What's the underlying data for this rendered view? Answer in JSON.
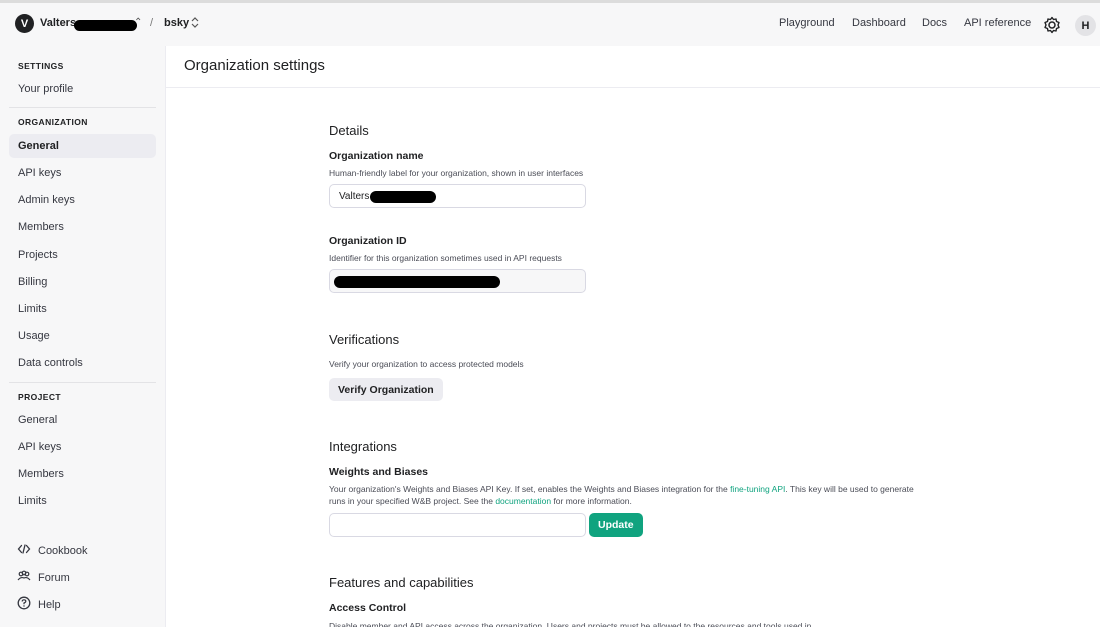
{
  "topbar": {
    "org_initial": "V",
    "org_name": "Valters",
    "project_name": "bsky",
    "separator": "/",
    "nav": [
      "Playground",
      "Dashboard",
      "Docs",
      "API reference"
    ],
    "user_initial": "H"
  },
  "sidebar": {
    "settings_head": "SETTINGS",
    "your_profile": "Your profile",
    "organization_head": "ORGANIZATION",
    "org_items": [
      "General",
      "API keys",
      "Admin keys",
      "Members",
      "Projects",
      "Billing",
      "Limits",
      "Usage",
      "Data controls"
    ],
    "project_head": "PROJECT",
    "project_items": [
      "General",
      "API keys",
      "Members",
      "Limits"
    ],
    "footer": [
      "Cookbook",
      "Forum",
      "Help"
    ]
  },
  "page": {
    "title": "Organization settings",
    "details": {
      "heading": "Details",
      "org_name_label": "Organization name",
      "org_name_help": "Human-friendly label for your organization, shown in user interfaces",
      "org_name_value": "Valters",
      "org_id_label": "Organization ID",
      "org_id_help": "Identifier for this organization sometimes used in API requests"
    },
    "verifications": {
      "heading": "Verifications",
      "help": "Verify your organization to access protected models",
      "button": "Verify Organization"
    },
    "integrations": {
      "heading": "Integrations",
      "wandb_label": "Weights and Biases",
      "help_part1": "Your organization's Weights and Biases API Key. If set, enables the Weights and Biases integration for the ",
      "help_link1": "fine-tuning API",
      "help_part2": ". This key will be used to generate runs in your specified W&B project. See the ",
      "help_link2": "documentation",
      "help_part3": " for more information.",
      "input_value": "",
      "update_button": "Update"
    },
    "features": {
      "heading": "Features and capabilities",
      "access_label": "Access Control",
      "access_help": "Disable member and API access across the organization. Users and projects must be allowed to the resources and tools used in ..."
    }
  }
}
